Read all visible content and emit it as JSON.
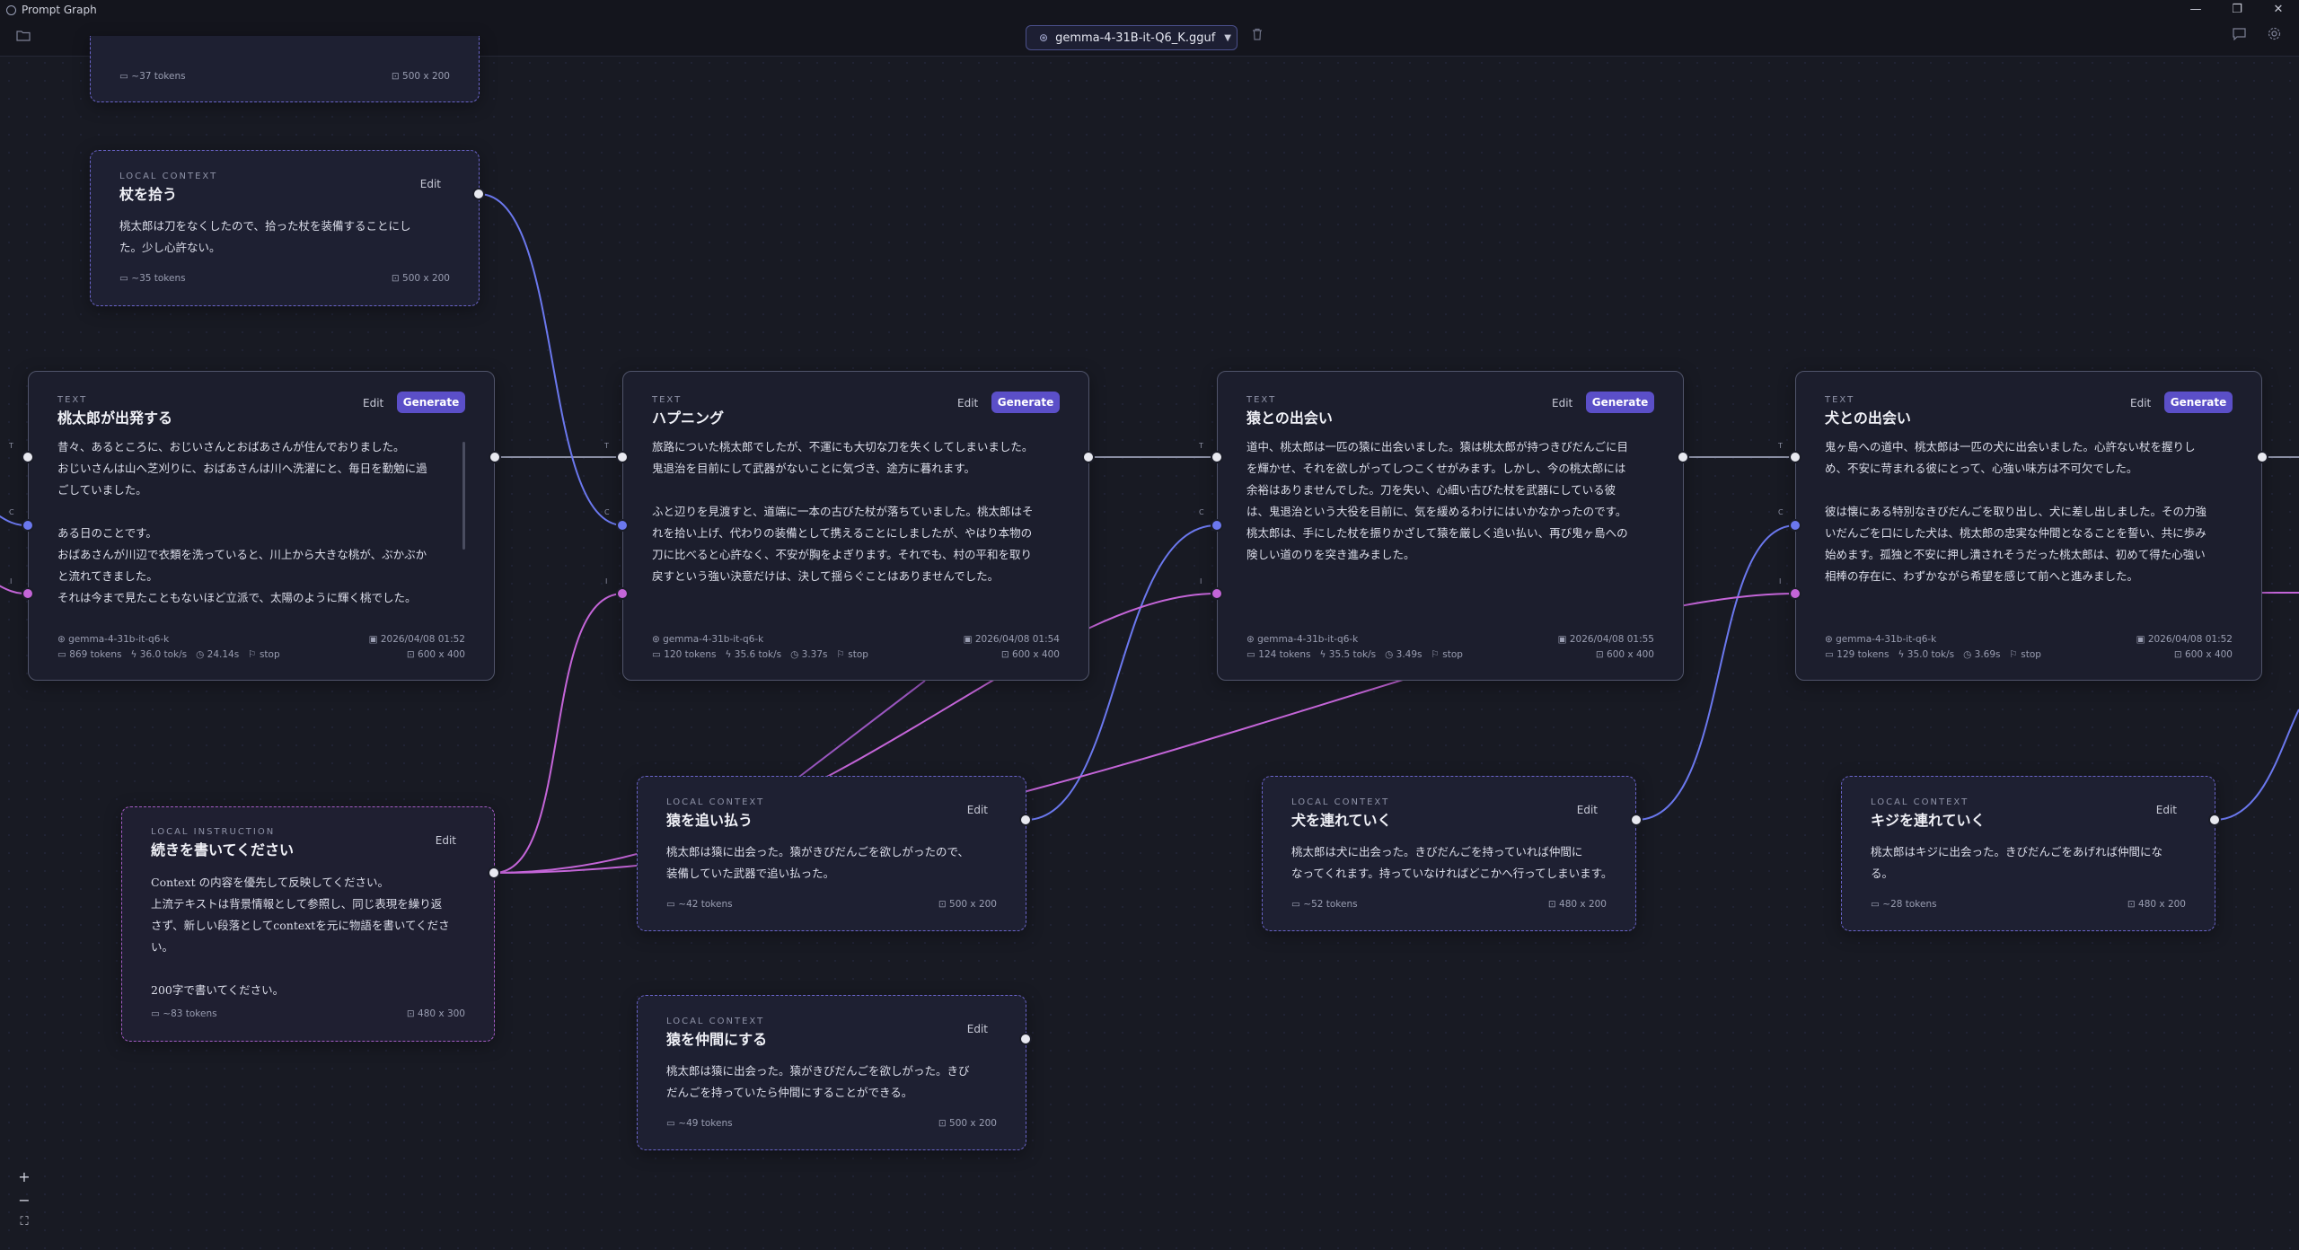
{
  "window": {
    "title": "Prompt Graph",
    "controls": [
      "—",
      "❐",
      "✕"
    ]
  },
  "toolbar": {
    "model": "gemma-4-31B-it-Q6_K.gguf"
  },
  "colors": {
    "background": "#181a23",
    "accent": "#5b4fc8",
    "context_wire": "#6b78ee",
    "instruction_wire": "#c465d8",
    "text_wire": "#8a8ea3"
  },
  "ports": {
    "t": "T",
    "c": "C",
    "i": "I"
  },
  "nodes": {
    "top_partial": {
      "tokens": "~37 tokens",
      "size": "500 x 200"
    },
    "ctx_staff": {
      "type": "LOCAL CONTEXT",
      "title": "杖を拾う",
      "edit": "Edit",
      "body": "桃太郎は刀をなくしたので、拾った杖を装備することにし\nた。少し心許ない。",
      "tokens": "~35 tokens",
      "size": "500 x 200"
    },
    "text1": {
      "type": "TEXT",
      "title": "桃太郎が出発する",
      "edit": "Edit",
      "generate": "Generate",
      "body": "昔々、あるところに、おじいさんとおばあさんが住んでおりました。\nおじいさんは山へ芝刈りに、おばあさんは川へ洗濯にと、毎日を勤勉に過\nごしていました。\n\nある日のことです。\nおばあさんが川辺で衣類を洗っていると、川上から大きな桃が、ぶかぶか\nと流れてきました。\nそれは今まで見たこともないほど立派で、太陽のように輝く桃でした。",
      "model": "gemma-4-31b-it-q6-k",
      "date": "2026/04/08 01:52",
      "tokens": "869 tokens",
      "speed": "36.0 tok/s",
      "time": "24.14s",
      "stop": "stop",
      "size": "600 x 400"
    },
    "text2": {
      "type": "TEXT",
      "title": "ハプニング",
      "edit": "Edit",
      "generate": "Generate",
      "body": "旅路についた桃太郎でしたが、不運にも大切な刀を失くしてしまいました。\n鬼退治を目前にして武器がないことに気づき、途方に暮れます。\n\nふと辺りを見渡すと、道端に一本の古びた杖が落ちていました。桃太郎はそ\nれを拾い上げ、代わりの装備として携えることにしましたが、やはり本物の\n刀に比べると心許なく、不安が胸をよぎります。それでも、村の平和を取り\n戻すという強い決意だけは、決して揺らぐことはありませんでした。",
      "model": "gemma-4-31b-it-q6-k",
      "date": "2026/04/08 01:54",
      "tokens": "120 tokens",
      "speed": "35.6 tok/s",
      "time": "3.37s",
      "stop": "stop",
      "size": "600 x 400"
    },
    "text3": {
      "type": "TEXT",
      "title": "猿との出会い",
      "edit": "Edit",
      "generate": "Generate",
      "body": "道中、桃太郎は一匹の猿に出会いました。猿は桃太郎が持つきびだんごに目\nを輝かせ、それを欲しがってしつこくせがみます。しかし、今の桃太郎には\n余裕はありませんでした。刀を失い、心細い古びた杖を武器にしている彼\nは、鬼退治という大役を目前に、気を緩めるわけにはいかなかったのです。\n桃太郎は、手にした杖を振りかざして猿を厳しく追い払い、再び鬼ヶ島への\n険しい道のりを突き進みました。",
      "model": "gemma-4-31b-it-q6-k",
      "date": "2026/04/08 01:55",
      "tokens": "124 tokens",
      "speed": "35.5 tok/s",
      "time": "3.49s",
      "stop": "stop",
      "size": "600 x 400"
    },
    "text4": {
      "type": "TEXT",
      "title": "犬との出会い",
      "edit": "Edit",
      "generate": "Generate",
      "body": "鬼ヶ島への道中、桃太郎は一匹の犬に出会いました。心許ない杖を握りし\nめ、不安に苛まれる彼にとって、心強い味方は不可欠でした。\n\n彼は懐にある特別なきびだんごを取り出し、犬に差し出しました。その力強\nいだんごを口にした犬は、桃太郎の忠実な仲間となることを誓い、共に歩み\n始めます。孤独と不安に押し潰されそうだった桃太郎は、初めて得た心強い\n相棒の存在に、わずかながら希望を感じて前へと進みました。",
      "model": "gemma-4-31b-it-q6-k",
      "date": "2026/04/08 01:52",
      "tokens": "129 tokens",
      "speed": "35.0 tok/s",
      "time": "3.69s",
      "stop": "stop",
      "size": "600 x 400"
    },
    "instr": {
      "type": "LOCAL INSTRUCTION",
      "title": "続きを書いてください",
      "edit": "Edit",
      "body": "Context の内容を優先して反映してください。\n上流テキストは背景情報として参照し、同じ表現を繰り返\nさず、新しい段落としてcontextを元に物語を書いてくださ\nい。\n\n200字で書いてください。",
      "tokens": "~83 tokens",
      "size": "480 x 300"
    },
    "ctx_monkey_chase": {
      "type": "LOCAL CONTEXT",
      "title": "猿を追い払う",
      "edit": "Edit",
      "body": "桃太郎は猿に出会った。猿がきびだんごを欲しがったので、\n装備していた武器で追い払った。",
      "tokens": "~42 tokens",
      "size": "500 x 200"
    },
    "ctx_dog": {
      "type": "LOCAL CONTEXT",
      "title": "犬を連れていく",
      "edit": "Edit",
      "body": "桃太郎は犬に出会った。きびだんごを持っていれば仲間に\nなってくれます。持っていなければどこかへ行ってしまいます。",
      "tokens": "~52 tokens",
      "size": "480 x 200"
    },
    "ctx_pheasant": {
      "type": "LOCAL CONTEXT",
      "title": "キジを連れていく",
      "edit": "Edit",
      "body": "桃太郎はキジに出会った。きびだんごをあげれば仲間にな\nる。",
      "tokens": "~28 tokens",
      "size": "480 x 200"
    },
    "ctx_monkey_ally": {
      "type": "LOCAL CONTEXT",
      "title": "猿を仲間にする",
      "edit": "Edit",
      "body": "桃太郎は猿に出会った。猿がきびだんごを欲しがった。きび\nだんごを持っていたら仲間にすることができる。",
      "tokens": "~49 tokens",
      "size": "500 x 200"
    }
  },
  "zoom": {
    "in": "+",
    "out": "−",
    "fit": "⛶"
  }
}
